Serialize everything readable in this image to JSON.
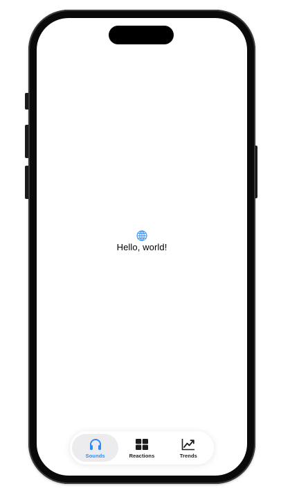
{
  "screen": {
    "greeting": "Hello, world!",
    "greeting_icon": "globe-icon"
  },
  "tabbar": {
    "items": [
      {
        "label": "Sounds",
        "icon": "headphones-icon",
        "selected": true
      },
      {
        "label": "Reactions",
        "icon": "grid-icon",
        "selected": false
      },
      {
        "label": "Trends",
        "icon": "chart-line-icon",
        "selected": false
      }
    ]
  },
  "colors": {
    "accent": "#2f8cf5",
    "tab_selected_bg": "#ececee",
    "frame": "#0a0a0a"
  }
}
